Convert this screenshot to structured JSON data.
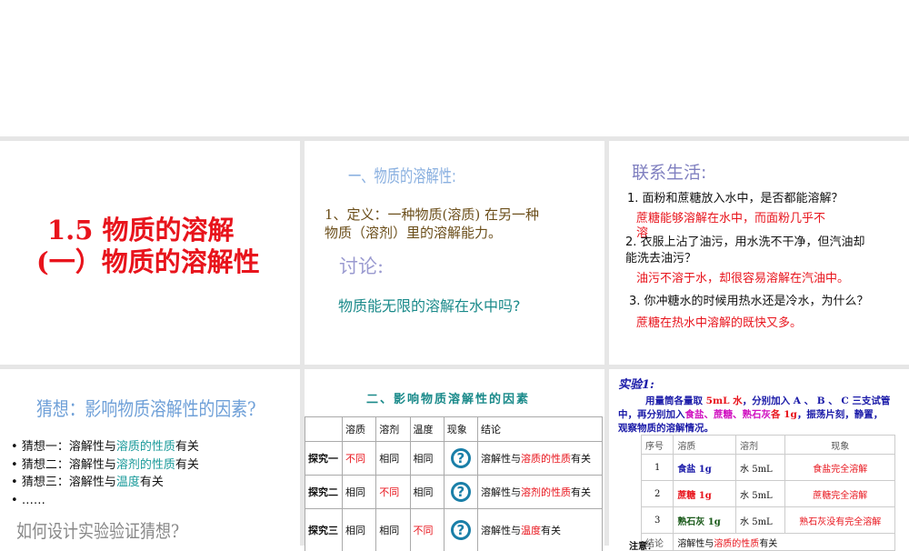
{
  "slides": {
    "s1": {
      "title_line1": "1.5   物质的溶解",
      "title_line2": "(一）物质的溶解性"
    },
    "s2": {
      "heading": "一、物质的溶解性:",
      "def_line1": "1、定义：一种物质(溶质) 在另一种",
      "def_line2": "物质（溶剂）里的溶解能力。",
      "discuss": "讨论:",
      "question": "物质能无限的溶解在水中吗?"
    },
    "s3": {
      "heading": "联系生活:",
      "q1": "1. 面粉和蔗糖放入水中，是否都能溶解？",
      "a1_line1": "蔗糖能够溶解在水中，而面粉几乎不",
      "a1_line2": "溶",
      "q2_line1": "2. 衣服上沾了油污，用水洗不干净，但汽油却",
      "q2_line2": "能洗去油污？",
      "a2": "油污不溶于水，却很容易溶解在汽油中。",
      "q3": "3. 你冲糖水的时候用热水还是冷水，为什么？",
      "a3": "蔗糖在热水中溶解的既快又多。"
    },
    "s4": {
      "heading": "猜想：影响物质溶解性的因素?",
      "bullets": [
        {
          "pre": "猜想一：溶解性与",
          "hl": "溶质的性质",
          "post": "有关"
        },
        {
          "pre": "猜想二：溶解性与",
          "hl": "溶剂的性质",
          "post": "有关"
        },
        {
          "pre": "猜想三：溶解性与",
          "hl": "温度",
          "post": "有关"
        },
        {
          "pre": "……",
          "hl": "",
          "post": ""
        }
      ],
      "footer": "如何设计实验验证猜想?"
    },
    "s5": {
      "heading": "二、影响物质溶解性的因素",
      "headers": [
        "",
        "溶质",
        "溶剂",
        "温度",
        "现象",
        "结论"
      ],
      "rows": [
        {
          "name": "探究一",
          "c1": "不同",
          "c2": "相同",
          "c3": "相同",
          "icon": "?",
          "pre": "溶解性与",
          "hl": "溶质的性质",
          "post": "有关"
        },
        {
          "name": "探究二",
          "c1": "相同",
          "c2": "不同",
          "c3": "相同",
          "icon": "?",
          "pre": "溶解性与",
          "hl": "溶剂的性质",
          "post": "有关"
        },
        {
          "name": "探究三",
          "c1": "相同",
          "c2": "相同",
          "c3": "不同",
          "icon": "?",
          "pre": "溶解性与",
          "hl": "温度",
          "post": "有关"
        }
      ]
    },
    "s6": {
      "heading": "实验1:",
      "p_a": "用量筒各量取 ",
      "p_b": "5mL 水",
      "p_c": "，分别加入 A 、 B 、 C 三支试管",
      "p2_a": "中，再分别加入",
      "p2_b": "食盐、蔗糖、熟石灰",
      "p2_c": "各 1g",
      "p2_d": "，振荡片刻，静置，",
      "p3": "观察物质的溶解情况。",
      "headers": [
        "序号",
        "溶质",
        "溶剂",
        "现象"
      ],
      "rows": [
        {
          "no": "1",
          "solute": "食盐 1g",
          "solvent": "水 5mL",
          "result": "食盐完全溶解",
          "color": "#1a1aa8"
        },
        {
          "no": "2",
          "solute": "蔗糖 1g",
          "solvent": "水 5mL",
          "result": "蔗糖完全溶解",
          "color": "#e8141c"
        },
        {
          "no": "3",
          "solute": "熟石灰 1g",
          "solvent": "水 5mL",
          "result": "熟石灰没有完全溶解",
          "color": "#1a5a1a"
        }
      ],
      "conclusion_label": "结论",
      "c_pre": "溶解性与",
      "c_hl": "溶质的性质",
      "c_post": "有关",
      "note": "注意："
    }
  }
}
